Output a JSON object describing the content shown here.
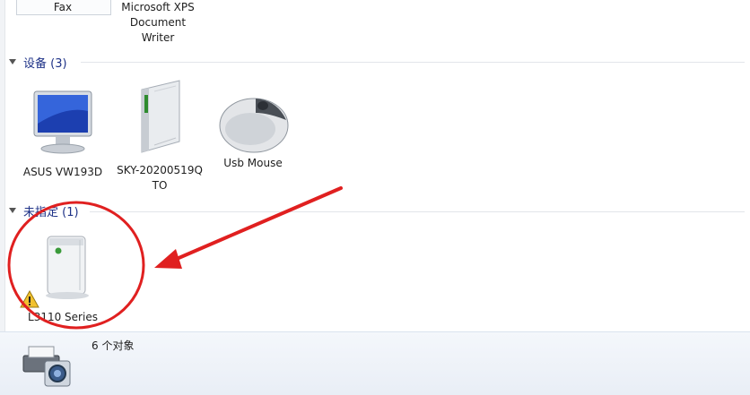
{
  "top_devices": [
    {
      "label": "Fax"
    },
    {
      "label_lines": [
        "Microsoft XPS",
        "Document",
        "Writer"
      ]
    }
  ],
  "groups": [
    {
      "title": "设备 (3)",
      "devices": [
        {
          "label": "ASUS VW193D",
          "icon": "monitor-icon"
        },
        {
          "label_lines": [
            "SKY-20200519Q",
            "TO"
          ],
          "icon": "computer-tower-icon"
        },
        {
          "label": "Usb Mouse",
          "icon": "mouse-icon"
        }
      ]
    },
    {
      "title": "未指定 (1)",
      "devices": [
        {
          "label": "L3110 Series",
          "icon": "printer-unspecified-icon",
          "warning": "warning-icon"
        }
      ]
    }
  ],
  "status": {
    "count": "6 个对象",
    "icon": "printer-camera-icon"
  },
  "annotation": {
    "color": "#e02020"
  }
}
